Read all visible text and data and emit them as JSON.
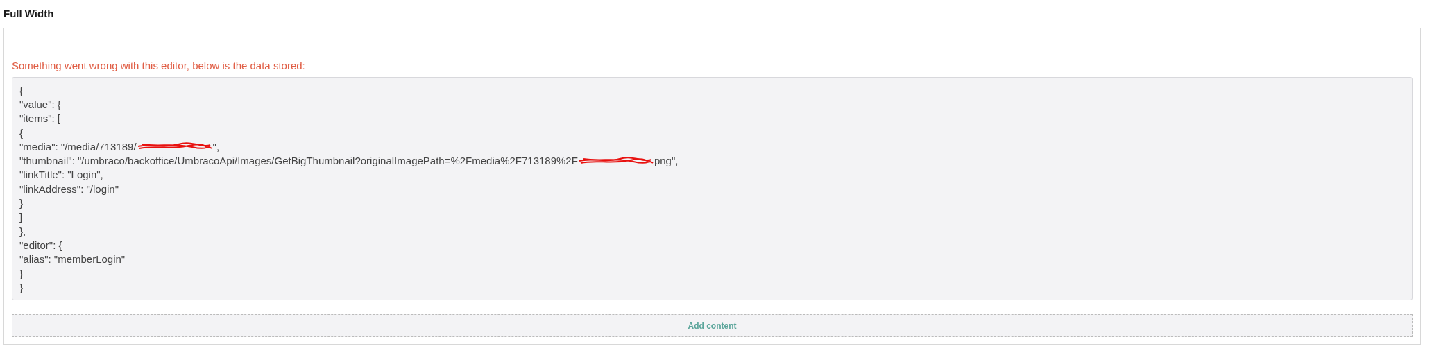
{
  "heading": "Full Width",
  "error_message": "Something went wrong with this editor, below is the data stored:",
  "stored_data_lines": [
    {
      "text": "{",
      "redacted": false
    },
    {
      "text": "\"value\": {",
      "redacted": false
    },
    {
      "text": "\"items\": [",
      "redacted": false
    },
    {
      "text": "{",
      "redacted": false
    },
    {
      "text": "\"media\": \"/media/713189/",
      "redacted": true,
      "after": "\","
    },
    {
      "text": "\"thumbnail\": \"/umbraco/backoffice/UmbracoApi/Images/GetBigThumbnail?originalImagePath=%2Fmedia%2F713189%2F",
      "redacted": true,
      "after": "png\","
    },
    {
      "text": "\"linkTitle\": \"Login\",",
      "redacted": false
    },
    {
      "text": "\"linkAddress\": \"/login\"",
      "redacted": false
    },
    {
      "text": "}",
      "redacted": false
    },
    {
      "text": "]",
      "redacted": false
    },
    {
      "text": "},",
      "redacted": false
    },
    {
      "text": "\"editor\": {",
      "redacted": false
    },
    {
      "text": "\"alias\": \"memberLogin\"",
      "redacted": false
    },
    {
      "text": "}",
      "redacted": false
    },
    {
      "text": "}",
      "redacted": false
    }
  ],
  "add_button": "Add content"
}
